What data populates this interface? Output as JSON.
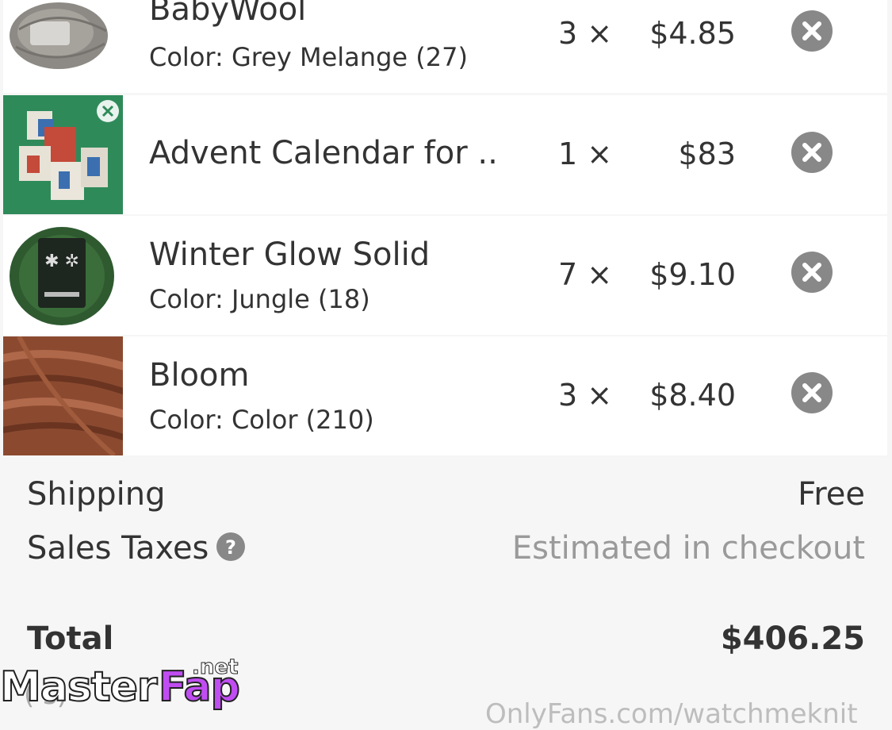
{
  "cart": {
    "items": [
      {
        "name": "BabyWool",
        "variant": "Color: Grey Melange (27)",
        "qty": "3 ×",
        "price": "$4.85"
      },
      {
        "name": "Advent Calendar for ..",
        "variant": "",
        "qty": "1 ×",
        "price": "$83"
      },
      {
        "name": "Winter Glow Solid",
        "variant": "Color: Jungle (18)",
        "qty": "7 ×",
        "price": "$9.10"
      },
      {
        "name": "Bloom",
        "variant": "Color: Color (210)",
        "qty": "3 ×",
        "price": "$8.40"
      }
    ]
  },
  "summary": {
    "shipping_label": "Shipping",
    "shipping_value": "Free",
    "taxes_label": "Sales Taxes",
    "taxes_value": "Estimated in checkout",
    "total_label": "Total",
    "total_value": "$406.25"
  },
  "footer": {
    "partial_sub": "(                    s)",
    "url": "OnlyFans.com/watchmeknit"
  },
  "watermark": {
    "part1": "Master",
    "part2": "Fap",
    "part3": ".net"
  },
  "icons": {
    "remove": "close-circle-icon",
    "help": "question-circle-icon"
  },
  "colors": {
    "remove_icon_bg": "#888888",
    "muted_text": "#9a9a9a"
  }
}
